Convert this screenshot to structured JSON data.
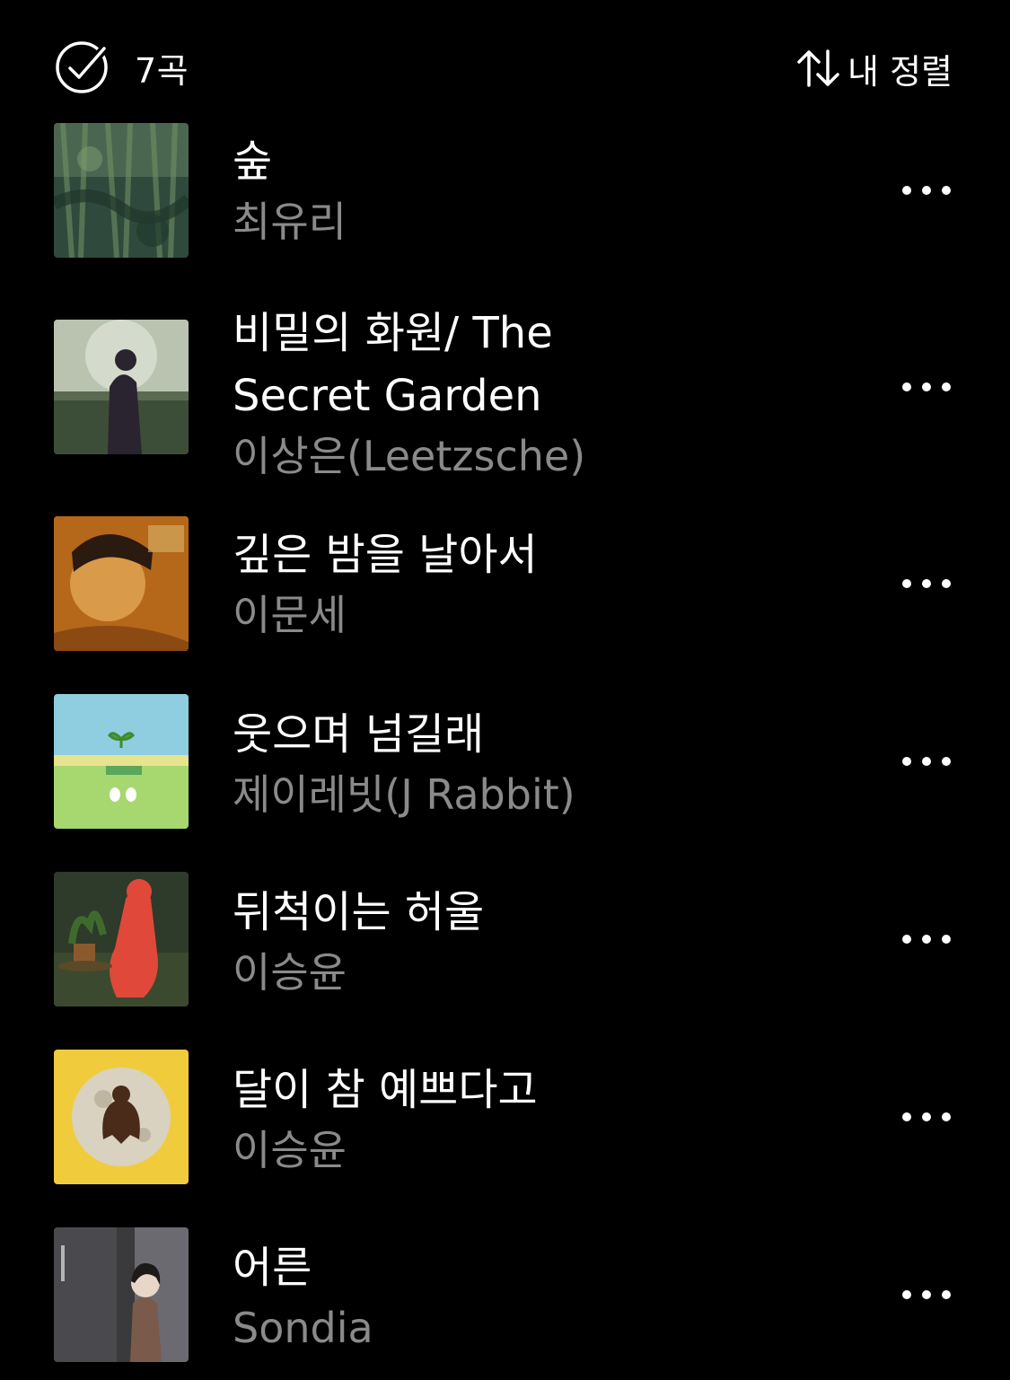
{
  "header": {
    "count_label": "7곡",
    "sort_label": "내 정렬"
  },
  "songs": [
    {
      "title": "숲",
      "artist": "최유리"
    },
    {
      "title": "비밀의 화원/ The Secret Garden",
      "artist": "이상은(Leetzsche)"
    },
    {
      "title": "깊은 밤을 날아서",
      "artist": "이문세"
    },
    {
      "title": "웃으며 넘길래",
      "artist": "제이레빗(J Rabbit)"
    },
    {
      "title": "뒤척이는 허울",
      "artist": "이승윤"
    },
    {
      "title": "달이 참 예쁘다고",
      "artist": "이승윤"
    },
    {
      "title": "어른",
      "artist": "Sondia"
    }
  ],
  "icons": {
    "select": "check-circle-icon",
    "sort": "sort-arrows-icon",
    "more": "more-horizontal-icon"
  },
  "colors": {
    "background": "#000000",
    "title": "#ffffff",
    "artist": "#8a8a8a"
  }
}
